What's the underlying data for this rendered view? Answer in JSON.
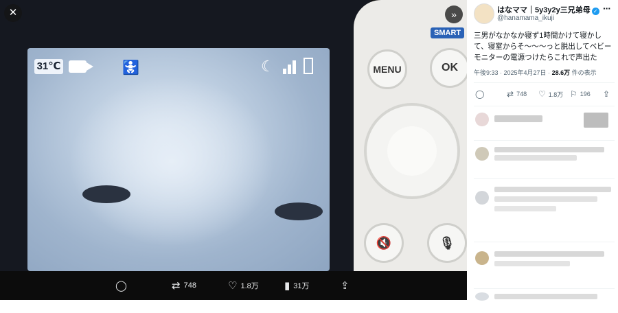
{
  "viewer": {
    "close_label": "✕",
    "expand_label": "»",
    "monitor": {
      "temperature": "31℃",
      "smart_label": "SMART",
      "menu_label": "MENU",
      "ok_label": "OK"
    },
    "actions": {
      "reply_count": "",
      "repost_count": "748",
      "like_count": "1.8万",
      "view_count": "31万"
    }
  },
  "post": {
    "author_name": "はなママ｜5y3y2y三兄弟母",
    "author_handle": "@hanamama_ikuji",
    "text": "三男がなかなか寝ず1時間かけて寝かして、寝室からそ〜〜〜っと脱出してベビーモニターの電源つけたらこれで声出た",
    "time": "午後9:33 · 2025年4月27日 · ",
    "views_count": "28.6万",
    "views_label": " 件の表示",
    "stats": {
      "reply_count": "",
      "repost_count": "748",
      "like_count": "1.8万",
      "bookmark_count": "196"
    }
  },
  "icons": {
    "reply": "reply-icon",
    "repost": "repost-icon",
    "like": "heart-icon",
    "views": "bar-chart-icon",
    "share": "share-icon",
    "bookmark": "bookmark-icon"
  },
  "colors": {
    "accent": "#1d9bf0",
    "verified": "#1d9bf0",
    "text": "#0f1419",
    "muted": "#536471"
  }
}
